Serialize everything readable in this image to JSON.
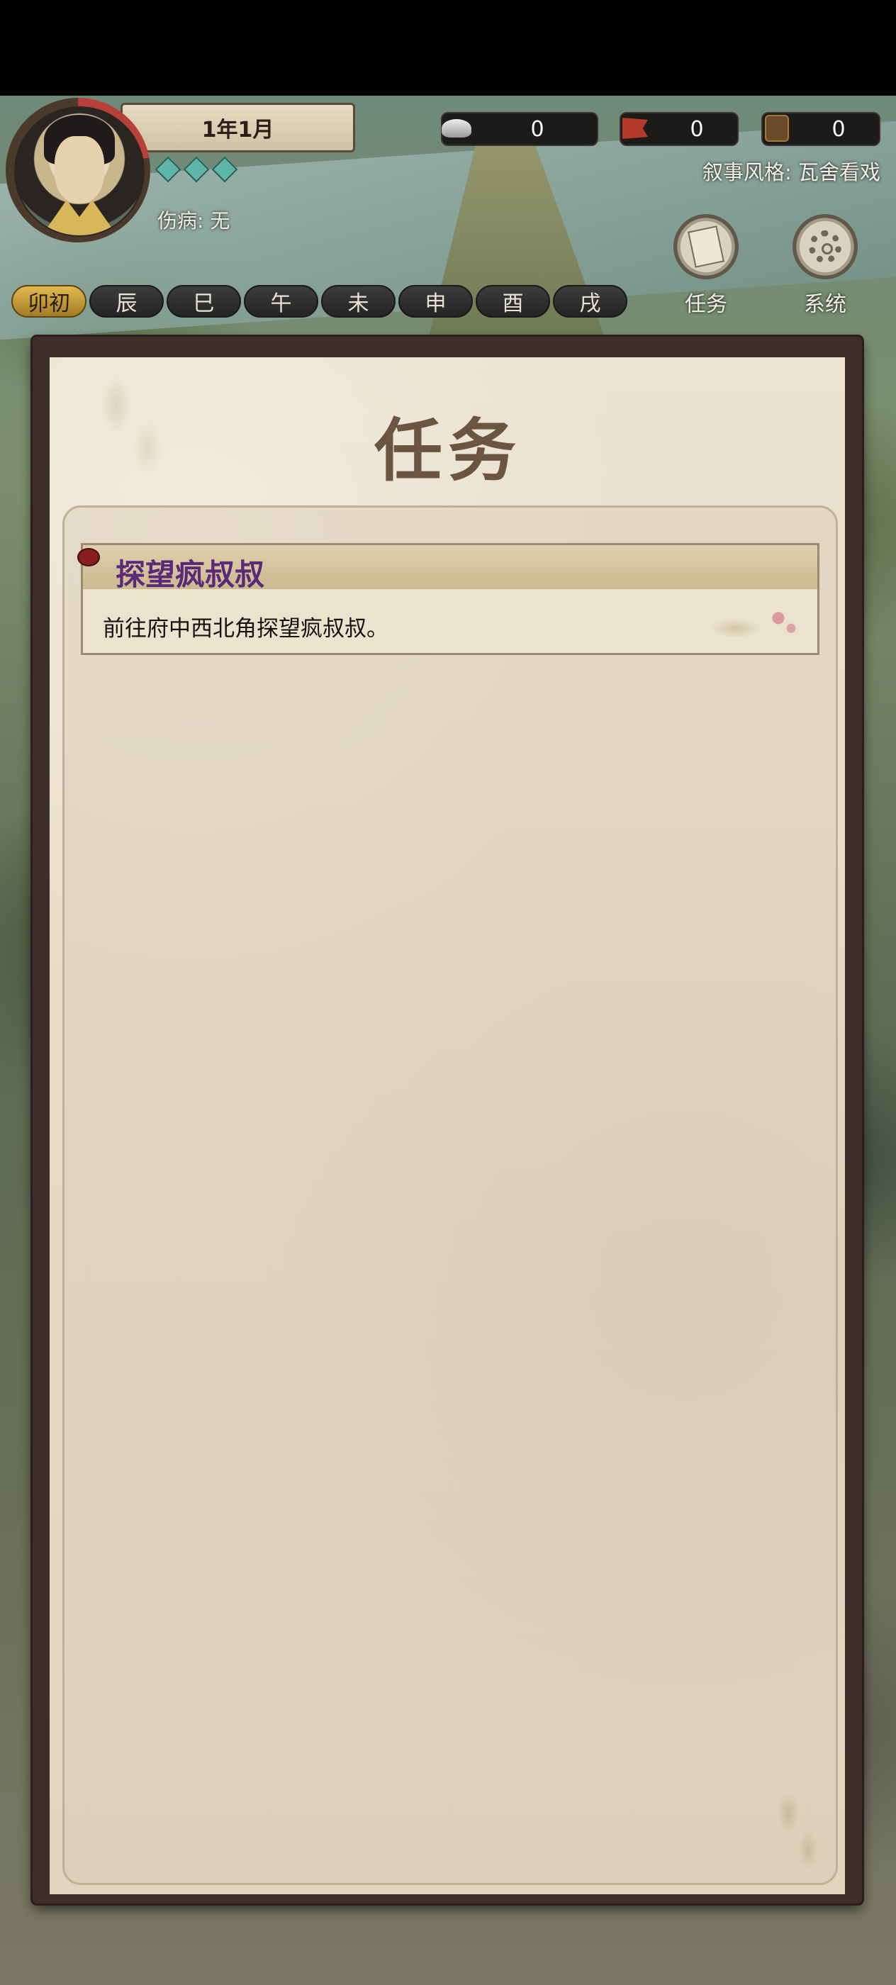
{
  "header": {
    "date": "1年1月",
    "injury": "伤病: 无",
    "narrative_style": "叙事风格: 瓦舍看戏",
    "gem_count": 3
  },
  "resources": [
    {
      "icon": "silver-ingot-icon",
      "value": "0"
    },
    {
      "icon": "flag-token-icon",
      "value": "0"
    },
    {
      "icon": "coin-token-icon",
      "value": "0"
    }
  ],
  "buttons": {
    "task": "任务",
    "system": "系统"
  },
  "time_slots": [
    "卯初",
    "辰",
    "巳",
    "午",
    "未",
    "申",
    "酉",
    "戌"
  ],
  "active_time_slot": "卯初",
  "panel": {
    "title": "任务",
    "tasks": [
      {
        "name": "探望疯叔叔",
        "description": "前往府中西北角探望疯叔叔。"
      }
    ]
  }
}
